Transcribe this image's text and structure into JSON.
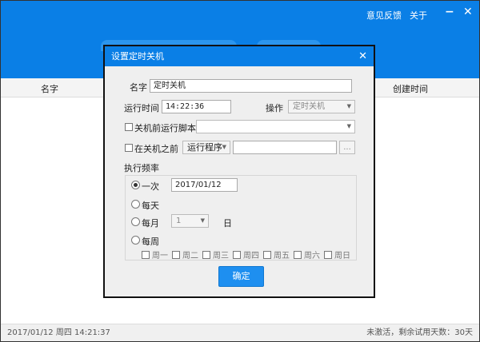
{
  "header": {
    "feedback": "意见反馈",
    "about": "关于",
    "minimize_icon": "minus",
    "close_icon": "x"
  },
  "columns": [
    "名字",
    "创建时间"
  ],
  "status": {
    "datetime": "2017/01/12  周四  14:21:37",
    "trial": "未激活，剩余试用天数：30天"
  },
  "dialog": {
    "title": "设置定时关机",
    "name_label": "名字",
    "name_value": "定时关机",
    "time_label": "运行时间",
    "time_value": "14:22:36",
    "action_label": "操作",
    "action_value": "定时关机",
    "script_label": "关机前运行脚本",
    "script_value": "",
    "before_label": "在关机之前",
    "before_button": "运行程序",
    "before_value": "",
    "browse": "...",
    "freq_label": "执行频率",
    "once": "一次",
    "once_date": "2017/01/12",
    "daily": "每天",
    "monthly": "每月",
    "month_day": "1",
    "day_unit": "日",
    "weekly": "每周",
    "weekdays": [
      "周一",
      "周二",
      "周三",
      "周四",
      "周五",
      "周六",
      "周日"
    ],
    "ok": "确定"
  }
}
